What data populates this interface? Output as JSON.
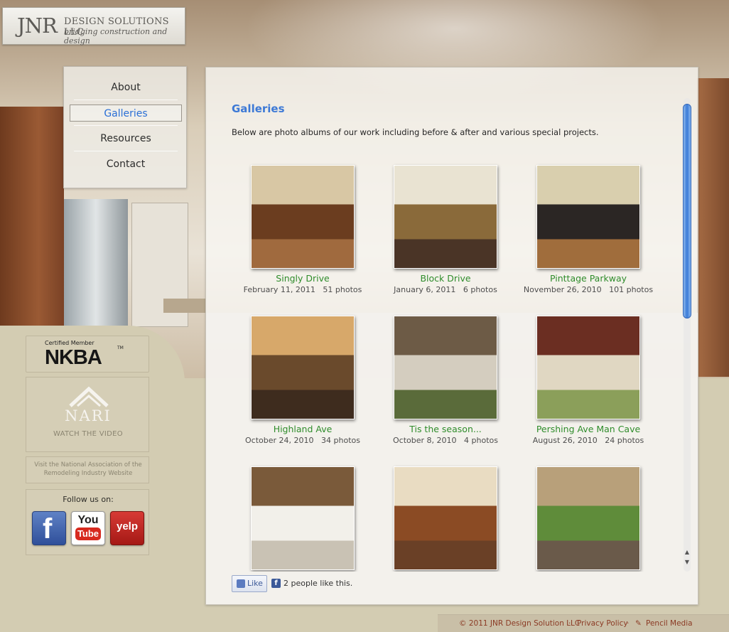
{
  "brand": {
    "mark": "JNR",
    "name": "DESIGN SOLUTIONS LLC",
    "tagline": "bridging construction and design"
  },
  "nav": {
    "items": [
      {
        "label": "About"
      },
      {
        "label": "Galleries"
      },
      {
        "label": "Resources"
      },
      {
        "label": "Contact"
      }
    ],
    "active": "Galleries"
  },
  "sidebar": {
    "nkba": {
      "certified": "Certified Member",
      "logo": "NKBA",
      "tm": "TM"
    },
    "nari": {
      "logo": "NARI",
      "watch": "WATCH THE VIDEO",
      "link": "Visit the National Association of the  Remodeling Industry Website"
    },
    "follow": {
      "title": "Follow us on:",
      "facebook": "f",
      "youtube_you": "You",
      "youtube_tube": "Tube",
      "yelp": "yelp"
    }
  },
  "main": {
    "heading": "Galleries",
    "intro": "Below are photo albums of our work including before & after and various special projects.",
    "albums": [
      {
        "title": "Singly Drive",
        "date": "February 11, 2011",
        "count": "51 photos",
        "icon": "kitchen-photo",
        "colors": [
          "#6b3d1f",
          "#d8c7a4",
          "#a06a3e"
        ]
      },
      {
        "title": "Block Drive",
        "date": "January 6, 2011",
        "count": "6 photos",
        "icon": "fireplace-photo",
        "colors": [
          "#8a6a3a",
          "#e9e3d2",
          "#4a3426"
        ]
      },
      {
        "title": "Pinttage Parkway",
        "date": "November 26, 2010",
        "count": "101 photos",
        "icon": "dark-kitchen-photo",
        "colors": [
          "#2b2624",
          "#d9cfae",
          "#a06d3c"
        ]
      },
      {
        "title": "Highland Ave",
        "date": "October 24, 2010",
        "count": "34 photos",
        "icon": "chandelier-photo",
        "colors": [
          "#6a4a2c",
          "#d7a86a",
          "#3e2c1e"
        ]
      },
      {
        "title": "Tis the season...",
        "date": "October 8, 2010",
        "count": "4 photos",
        "icon": "fireplace-photo",
        "colors": [
          "#d4cdbf",
          "#6d5b46",
          "#5a6b3a"
        ]
      },
      {
        "title": "Pershing Ave Man Cave",
        "date": "August 26, 2010",
        "count": "24 photos",
        "icon": "garage-photo",
        "colors": [
          "#e0d7c2",
          "#6b2e22",
          "#8b9f5a"
        ]
      },
      {
        "title": "",
        "date": "",
        "count": "",
        "icon": "stair-photo",
        "colors": [
          "#f2f0ea",
          "#7a5a3a",
          "#c9c2b4"
        ]
      },
      {
        "title": "",
        "date": "",
        "count": "",
        "icon": "kitchen-photo",
        "colors": [
          "#8b4b24",
          "#e9dcc2",
          "#6a4026"
        ]
      },
      {
        "title": "",
        "date": "",
        "count": "",
        "icon": "garden-photo",
        "colors": [
          "#5f8c3a",
          "#b8a07a",
          "#6a5a4a"
        ]
      }
    ]
  },
  "like_bar": {
    "button": "Like",
    "fb": "f",
    "count_text": "2 people like this."
  },
  "footer": {
    "copyright": "© 2011 JNR Design Solution LLC",
    "sep": "·",
    "privacy": "Privacy Policy",
    "credit": "Pencil Media"
  },
  "scroll": {
    "up": "▲",
    "down": "▼"
  }
}
